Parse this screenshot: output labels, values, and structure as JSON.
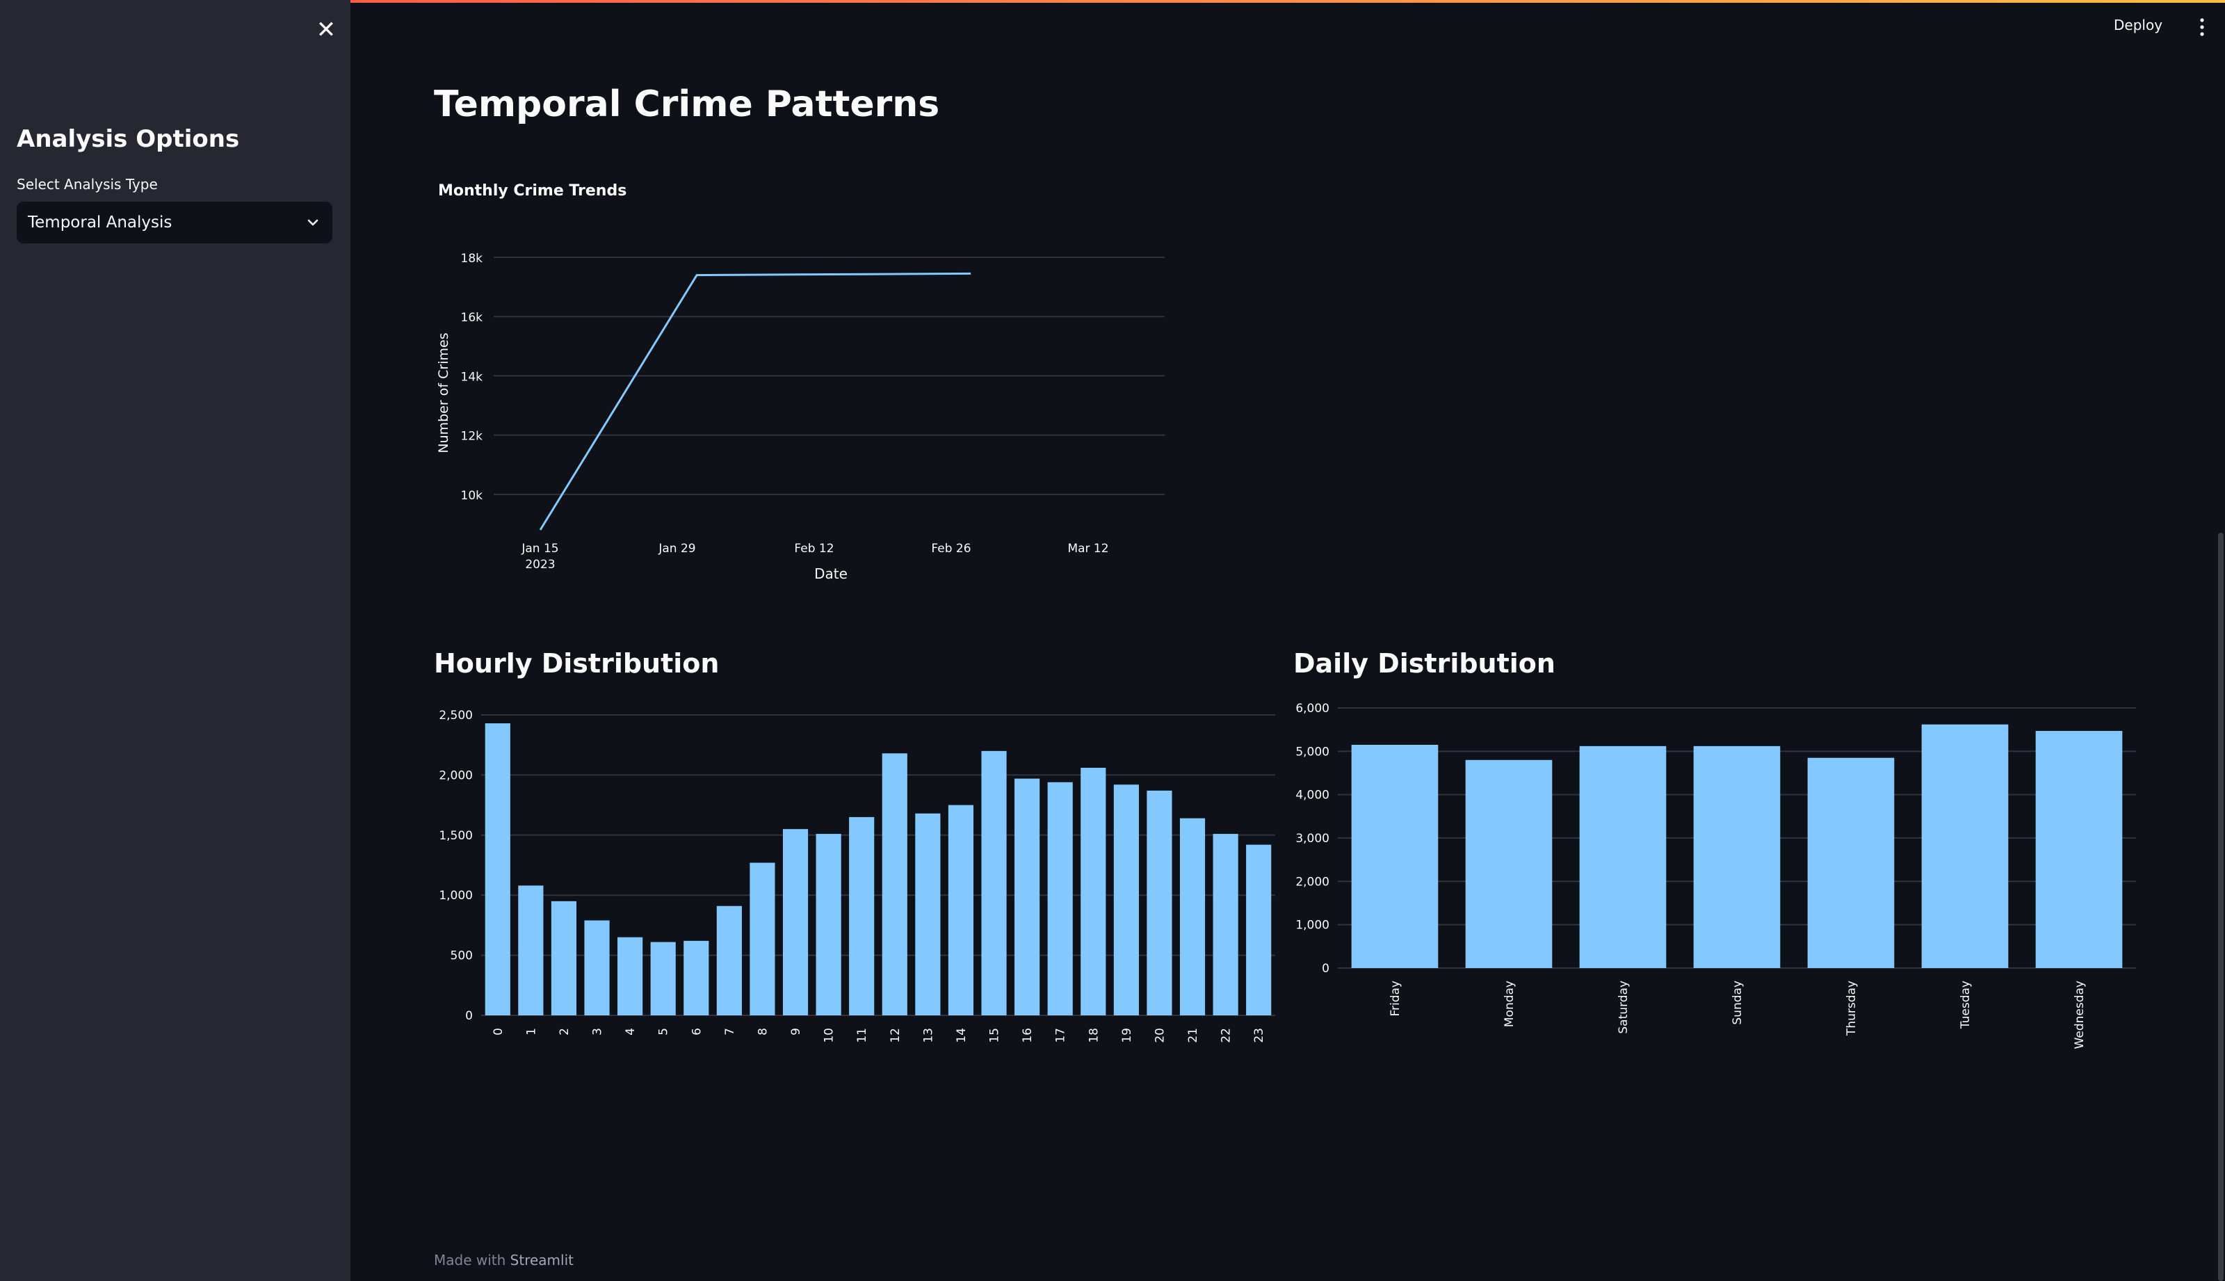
{
  "sidebar": {
    "title": "Analysis Options",
    "select_label": "Select Analysis Type",
    "select_value": "Temporal Analysis"
  },
  "header": {
    "deploy_label": "Deploy"
  },
  "page": {
    "title": "Temporal Crime Patterns"
  },
  "footer": {
    "prefix": "Made with",
    "brand": "Streamlit"
  },
  "colors": {
    "bar": "#83c9ff",
    "line": "#83c9ff",
    "background": "#0e1117",
    "sidebar": "#262730"
  },
  "chart_data": [
    {
      "type": "line",
      "title": "Monthly Crime Trends",
      "xlabel": "Date",
      "ylabel": "Number of Crimes",
      "x_ticks": [
        "Jan 15",
        "Jan 29",
        "Feb 12",
        "Feb 26",
        "Mar 12"
      ],
      "x_tick_year": "2023",
      "y_ticks": [
        "10k",
        "12k",
        "14k",
        "16k",
        "18k"
      ],
      "x": [
        "2023-01-15",
        "2023-01-31",
        "2023-02-28"
      ],
      "y": [
        8800,
        17400,
        17450
      ],
      "ylim": [
        8800,
        18000
      ],
      "grid": true
    },
    {
      "type": "bar",
      "title": "Hourly Distribution",
      "categories": [
        "0",
        "1",
        "2",
        "3",
        "4",
        "5",
        "6",
        "7",
        "8",
        "9",
        "10",
        "11",
        "12",
        "13",
        "14",
        "15",
        "16",
        "17",
        "18",
        "19",
        "20",
        "21",
        "22",
        "23"
      ],
      "values": [
        2430,
        1080,
        950,
        790,
        650,
        610,
        620,
        910,
        1270,
        1550,
        1510,
        1650,
        2180,
        1680,
        1750,
        2200,
        1970,
        1940,
        2060,
        1920,
        1870,
        1640,
        1510,
        1420
      ],
      "y_ticks": [
        "0",
        "500",
        "1,000",
        "1,500",
        "2,000",
        "2,500"
      ],
      "ylim": [
        0,
        2500
      ],
      "grid": true
    },
    {
      "type": "bar",
      "title": "Daily Distribution",
      "categories": [
        "Friday",
        "Monday",
        "Saturday",
        "Sunday",
        "Thursday",
        "Tuesday",
        "Wednesday"
      ],
      "values": [
        5150,
        4800,
        5120,
        5120,
        4850,
        5620,
        5470
      ],
      "y_ticks": [
        "0",
        "1,000",
        "2,000",
        "3,000",
        "4,000",
        "5,000",
        "6,000"
      ],
      "ylim": [
        0,
        6000
      ],
      "grid": true
    }
  ]
}
